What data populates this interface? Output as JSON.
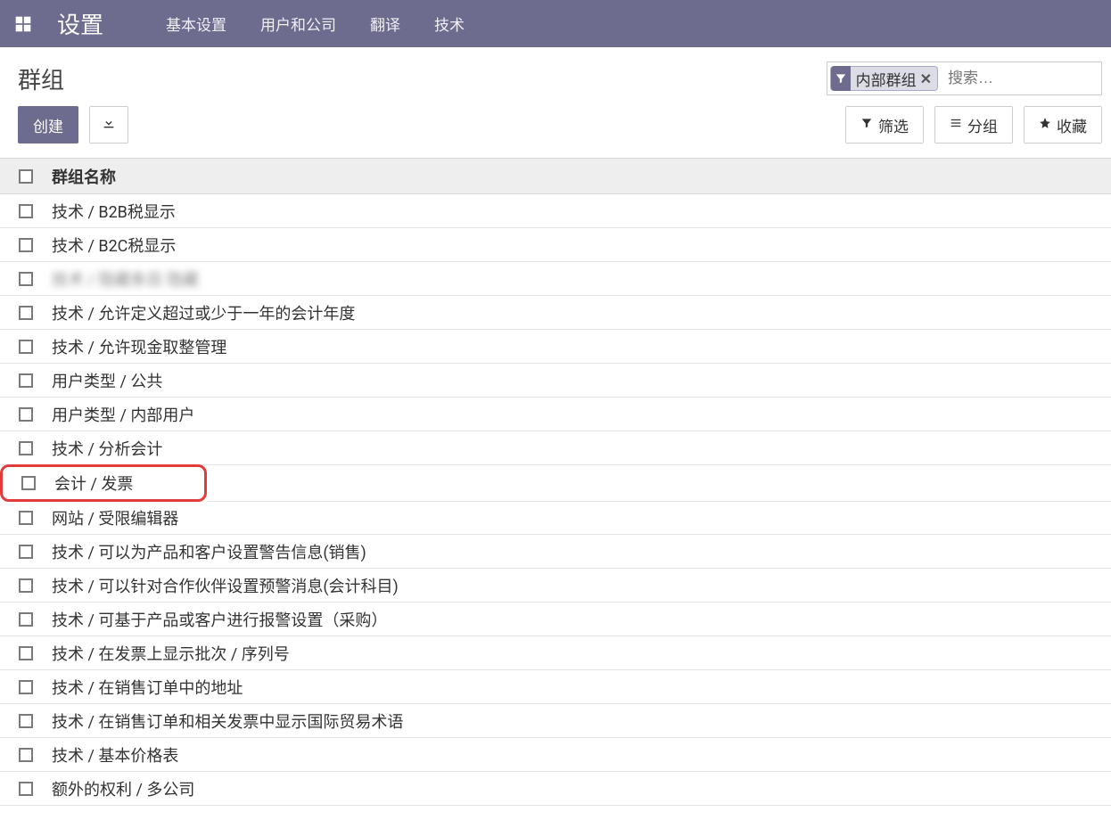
{
  "topbar": {
    "app_title": "设置",
    "nav": [
      "基本设置",
      "用户和公司",
      "翻译",
      "技术"
    ]
  },
  "page": {
    "title": "群组"
  },
  "search": {
    "filter_label": "内部群组",
    "placeholder": "搜索…"
  },
  "actions": {
    "create": "创建"
  },
  "view_buttons": {
    "filter": "筛选",
    "group": "分组",
    "favorite": "收藏"
  },
  "table": {
    "header": "群组名称",
    "rows": [
      {
        "label": "技术 / B2B税显示",
        "blurred": false,
        "highlight": false
      },
      {
        "label": "技术 / B2C税显示",
        "blurred": false,
        "highlight": false
      },
      {
        "label": "技术 / 隐藏条目 隐藏",
        "blurred": true,
        "highlight": false
      },
      {
        "label": "技术 / 允许定义超过或少于一年的会计年度",
        "blurred": false,
        "highlight": false
      },
      {
        "label": "技术 / 允许现金取整管理",
        "blurred": false,
        "highlight": false
      },
      {
        "label": "用户类型 / 公共",
        "blurred": false,
        "highlight": false
      },
      {
        "label": "用户类型 / 内部用户",
        "blurred": false,
        "highlight": false
      },
      {
        "label": "技术 / 分析会计",
        "blurred": false,
        "highlight": false
      },
      {
        "label": "会计 / 发票",
        "blurred": false,
        "highlight": true
      },
      {
        "label": "网站 / 受限编辑器",
        "blurred": false,
        "highlight": false
      },
      {
        "label": "技术 / 可以为产品和客户设置警告信息(销售)",
        "blurred": false,
        "highlight": false
      },
      {
        "label": "技术 / 可以针对合作伙伴设置预警消息(会计科目)",
        "blurred": false,
        "highlight": false
      },
      {
        "label": "技术 / 可基于产品或客户进行报警设置（采购）",
        "blurred": false,
        "highlight": false
      },
      {
        "label": "技术 / 在发票上显示批次 / 序列号",
        "blurred": false,
        "highlight": false
      },
      {
        "label": "技术 / 在销售订单中的地址",
        "blurred": false,
        "highlight": false
      },
      {
        "label": "技术 / 在销售订单和相关发票中显示国际贸易术语",
        "blurred": false,
        "highlight": false
      },
      {
        "label": "技术 / 基本价格表",
        "blurred": false,
        "highlight": false
      },
      {
        "label": "额外的权利 / 多公司",
        "blurred": false,
        "highlight": false
      }
    ]
  }
}
